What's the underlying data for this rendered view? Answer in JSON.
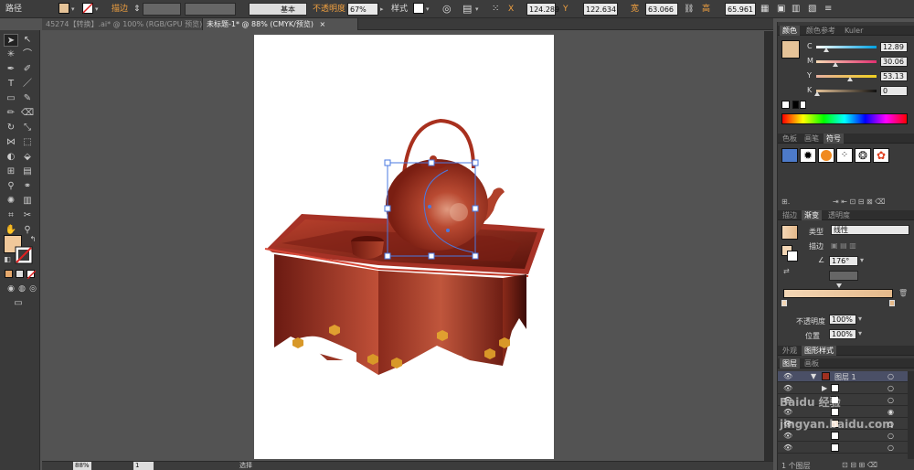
{
  "control_bar": {
    "path_label": "路径",
    "stroke_label": "描边",
    "stroke_profile": "基本",
    "opacity_label": "不透明度",
    "opacity_value": "67%",
    "style_label": "样式",
    "x_label": "X",
    "x_value": "124.289",
    "y_label": "Y",
    "y_value": "122.634",
    "w_label": "宽",
    "w_value": "63.066",
    "h_label": "高",
    "h_value": "65.961",
    "fill_color": "#e5c398"
  },
  "tabs": [
    {
      "label": "45274【转换】.ai* @ 100% (RGB/GPU 预览)",
      "active": false
    },
    {
      "label": "未标题-1* @ 88% (CMYK/预览)",
      "active": true
    }
  ],
  "color_panel": {
    "tabs": [
      "颜色",
      "颜色参考",
      "Kuler"
    ],
    "c_label": "C",
    "c_value": "12.89",
    "m_label": "M",
    "m_value": "30.06",
    "y_label": "Y",
    "y_value": "53.13",
    "k_label": "K",
    "k_value": "0",
    "current_color": "#e5c398"
  },
  "swatch_panel": {
    "tabs": [
      "色板",
      "画笔",
      "符号"
    ]
  },
  "gradient_panel": {
    "tabs": [
      "描边",
      "渐变",
      "透明度"
    ],
    "type_label": "类型",
    "type_value": "线性",
    "stroke_label": "描边",
    "angle_value": "176°",
    "opacity_label": "不透明度",
    "opacity_value": "100%",
    "position_label": "位置",
    "position_value": "100%",
    "start_color": "#f3d6b5",
    "end_color": "#e5b98a"
  },
  "appearance_panel": {
    "tabs": [
      "外观",
      "图形样式"
    ]
  },
  "layers_panel": {
    "tabs": [
      "图层",
      "画板"
    ],
    "layer_name": "图层 1",
    "footer_label": "1 个图层"
  },
  "status_bar": {
    "zoom": "88%",
    "page": "1",
    "tool": "选择"
  },
  "watermark": "Baidu 经验  jingyan.baidu.com"
}
